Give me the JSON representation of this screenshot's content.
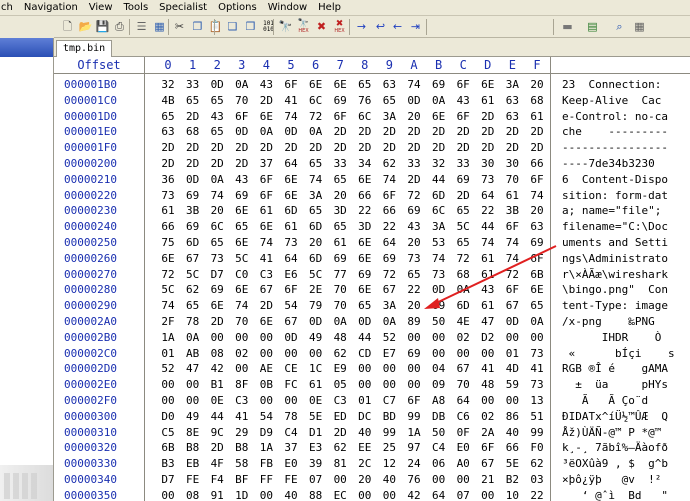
{
  "menu": {
    "items": [
      {
        "label": "ch"
      },
      {
        "label": "Navigation"
      },
      {
        "label": "View"
      },
      {
        "label": "Tools"
      },
      {
        "label": "Specialist"
      },
      {
        "label": "Options"
      },
      {
        "label": "Window"
      },
      {
        "label": "Help"
      }
    ]
  },
  "toolbar": {
    "icons": [
      "new-file-icon",
      "open-folder-icon",
      "save-icon",
      "print-icon",
      "properties-icon",
      "open-disk-icon",
      "cut-icon",
      "copy-icon",
      "paste-icon",
      "copy-block-icon",
      "paste-block-icon",
      "binary-icon",
      "find-icon",
      "find-hex-icon",
      "replace-icon",
      "replace-hex-icon",
      "goto-offset-icon",
      "back-icon",
      "forward-icon",
      "goto-sector-icon",
      "disk-icon",
      "ram-icon",
      "search-view-icon",
      "calculator-icon"
    ],
    "small_labels": {
      "binary": "101\n010",
      "hex1": "HEX",
      "hex2": "HEX"
    }
  },
  "tab": {
    "label": "tmp.bin"
  },
  "editor": {
    "header": {
      "offset_label": "Offset",
      "columns": [
        "0",
        "1",
        "2",
        "3",
        "4",
        "5",
        "6",
        "7",
        "8",
        "9",
        "A",
        "B",
        "C",
        "D",
        "E",
        "F"
      ]
    },
    "rows": [
      {
        "offset": "000001B0",
        "hex": [
          "32",
          "33",
          "0D",
          "0A",
          "43",
          "6F",
          "6E",
          "6E",
          "65",
          "63",
          "74",
          "69",
          "6F",
          "6E",
          "3A",
          "20"
        ],
        "ascii": "23  Connection:"
      },
      {
        "offset": "000001C0",
        "hex": [
          "4B",
          "65",
          "65",
          "70",
          "2D",
          "41",
          "6C",
          "69",
          "76",
          "65",
          "0D",
          "0A",
          "43",
          "61",
          "63",
          "68"
        ],
        "ascii": "Keep-Alive  Cac"
      },
      {
        "offset": "000001D0",
        "hex": [
          "65",
          "2D",
          "43",
          "6F",
          "6E",
          "74",
          "72",
          "6F",
          "6C",
          "3A",
          "20",
          "6E",
          "6F",
          "2D",
          "63",
          "61"
        ],
        "ascii": "e-Control: no-ca"
      },
      {
        "offset": "000001E0",
        "hex": [
          "63",
          "68",
          "65",
          "0D",
          "0A",
          "0D",
          "0A",
          "2D",
          "2D",
          "2D",
          "2D",
          "2D",
          "2D",
          "2D",
          "2D",
          "2D"
        ],
        "ascii": "che    ---------"
      },
      {
        "offset": "000001F0",
        "hex": [
          "2D",
          "2D",
          "2D",
          "2D",
          "2D",
          "2D",
          "2D",
          "2D",
          "2D",
          "2D",
          "2D",
          "2D",
          "2D",
          "2D",
          "2D",
          "2D"
        ],
        "ascii": "----------------"
      },
      {
        "offset": "00000200",
        "hex": [
          "2D",
          "2D",
          "2D",
          "2D",
          "37",
          "64",
          "65",
          "33",
          "34",
          "62",
          "33",
          "32",
          "33",
          "30",
          "30",
          "66"
        ],
        "ascii": "----7de34b3230"
      },
      {
        "offset": "00000210",
        "hex": [
          "36",
          "0D",
          "0A",
          "43",
          "6F",
          "6E",
          "74",
          "65",
          "6E",
          "74",
          "2D",
          "44",
          "69",
          "73",
          "70",
          "6F"
        ],
        "ascii": "6  Content-Dispo"
      },
      {
        "offset": "00000220",
        "hex": [
          "73",
          "69",
          "74",
          "69",
          "6F",
          "6E",
          "3A",
          "20",
          "66",
          "6F",
          "72",
          "6D",
          "2D",
          "64",
          "61",
          "74"
        ],
        "ascii": "sition: form-dat"
      },
      {
        "offset": "00000230",
        "hex": [
          "61",
          "3B",
          "20",
          "6E",
          "61",
          "6D",
          "65",
          "3D",
          "22",
          "66",
          "69",
          "6C",
          "65",
          "22",
          "3B",
          "20"
        ],
        "ascii": "a; name=\"file\"; "
      },
      {
        "offset": "00000240",
        "hex": [
          "66",
          "69",
          "6C",
          "65",
          "6E",
          "61",
          "6D",
          "65",
          "3D",
          "22",
          "43",
          "3A",
          "5C",
          "44",
          "6F",
          "63"
        ],
        "ascii": "filename=\"C:\\Doc"
      },
      {
        "offset": "00000250",
        "hex": [
          "75",
          "6D",
          "65",
          "6E",
          "74",
          "73",
          "20",
          "61",
          "6E",
          "64",
          "20",
          "53",
          "65",
          "74",
          "74",
          "69"
        ],
        "ascii": "uments and Setti"
      },
      {
        "offset": "00000260",
        "hex": [
          "6E",
          "67",
          "73",
          "5C",
          "41",
          "64",
          "6D",
          "69",
          "6E",
          "69",
          "73",
          "74",
          "72",
          "61",
          "74",
          "6F"
        ],
        "ascii": "ngs\\Administrato"
      },
      {
        "offset": "00000270",
        "hex": [
          "72",
          "5C",
          "D7",
          "C0",
          "C3",
          "E6",
          "5C",
          "77",
          "69",
          "72",
          "65",
          "73",
          "68",
          "61",
          "72",
          "6B"
        ],
        "ascii": "r\\×ÀÃæ\\wireshark"
      },
      {
        "offset": "00000280",
        "hex": [
          "5C",
          "62",
          "69",
          "6E",
          "67",
          "6F",
          "2E",
          "70",
          "6E",
          "67",
          "22",
          "0D",
          "0A",
          "43",
          "6F",
          "6E"
        ],
        "ascii": "\\bingo.png\"  Con"
      },
      {
        "offset": "00000290",
        "hex": [
          "74",
          "65",
          "6E",
          "74",
          "2D",
          "54",
          "79",
          "70",
          "65",
          "3A",
          "20",
          "69",
          "6D",
          "61",
          "67",
          "65"
        ],
        "ascii": "tent-Type: image"
      },
      {
        "offset": "000002A0",
        "hex": [
          "2F",
          "78",
          "2D",
          "70",
          "6E",
          "67",
          "0D",
          "0A",
          "0D",
          "0A",
          "89",
          "50",
          "4E",
          "47",
          "0D",
          "0A"
        ],
        "ascii": "/x-png    ‰PNG  "
      },
      {
        "offset": "000002B0",
        "hex": [
          "1A",
          "0A",
          "00",
          "00",
          "00",
          "0D",
          "49",
          "48",
          "44",
          "52",
          "00",
          "00",
          "02",
          "D2",
          "00",
          "00"
        ],
        "ascii": "      IHDR    Ò  "
      },
      {
        "offset": "000002C0",
        "hex": [
          "01",
          "AB",
          "08",
          "02",
          "00",
          "00",
          "00",
          "62",
          "CD",
          "E7",
          "69",
          "00",
          "00",
          "00",
          "01",
          "73"
        ],
        "ascii": " «      bÍçi    s"
      },
      {
        "offset": "000002D0",
        "hex": [
          "52",
          "47",
          "42",
          "00",
          "AE",
          "CE",
          "1C",
          "E9",
          "00",
          "00",
          "00",
          "04",
          "67",
          "41",
          "4D",
          "41"
        ],
        "ascii": "RGB ®Î é    gAMA"
      },
      {
        "offset": "000002E0",
        "hex": [
          "00",
          "00",
          "B1",
          "8F",
          "0B",
          "FC",
          "61",
          "05",
          "00",
          "00",
          "00",
          "09",
          "70",
          "48",
          "59",
          "73"
        ],
        "ascii": "  ±  üa     pHYs"
      },
      {
        "offset": "000002F0",
        "hex": [
          "00",
          "00",
          "0E",
          "C3",
          "00",
          "00",
          "0E",
          "C3",
          "01",
          "C7",
          "6F",
          "A8",
          "64",
          "00",
          "00",
          "13"
        ],
        "ascii": "   Ã   Ã Ço¨d   "
      },
      {
        "offset": "00000300",
        "hex": [
          "D0",
          "49",
          "44",
          "41",
          "54",
          "78",
          "5E",
          "ED",
          "DC",
          "BD",
          "99",
          "DB",
          "C6",
          "02",
          "86",
          "51"
        ],
        "ascii": "ÐIDATx^íÜ½™ÛÆ  Q"
      },
      {
        "offset": "00000310",
        "hex": [
          "C5",
          "8E",
          "9C",
          "29",
          "D9",
          "C4",
          "D1",
          "2D",
          "40",
          "99",
          "1A",
          "50",
          "0F",
          "2A",
          "40",
          "99"
        ],
        "ascii": "Åž)ÙÄÑ-@™ P *@™"
      },
      {
        "offset": "00000320",
        "hex": [
          "6B",
          "B8",
          "2D",
          "B8",
          "1A",
          "37",
          "E3",
          "62",
          "EE",
          "25",
          "97",
          "C4",
          "E0",
          "6F",
          "66",
          "F0"
        ],
        "ascii": "k¸-¸ 7ãbî%—Äàofð"
      },
      {
        "offset": "00000330",
        "hex": [
          "B3",
          "EB",
          "4F",
          "58",
          "FB",
          "E0",
          "39",
          "81",
          "2C",
          "12",
          "24",
          "06",
          "A0",
          "67",
          "5E",
          "62"
        ],
        "ascii": "³ëOXûà9 , $  g^b"
      },
      {
        "offset": "00000340",
        "hex": [
          "D7",
          "FE",
          "F4",
          "BF",
          "FF",
          "FE",
          "07",
          "00",
          "20",
          "40",
          "76",
          "00",
          "00",
          "21",
          "B2",
          "03"
        ],
        "ascii": "×þô¿ÿþ   @v  !² "
      },
      {
        "offset": "00000350",
        "hex": [
          "00",
          "08",
          "91",
          "1D",
          "00",
          "40",
          "88",
          "EC",
          "00",
          "00",
          "42",
          "64",
          "07",
          "00",
          "10",
          "22"
        ],
        "ascii": "   ‘ @ˆì  Bd   \""
      }
    ]
  },
  "colors": {
    "offset_blue": "#1a2fb0",
    "menubar": "#ece9d8",
    "arrow_red": "#e02020"
  }
}
